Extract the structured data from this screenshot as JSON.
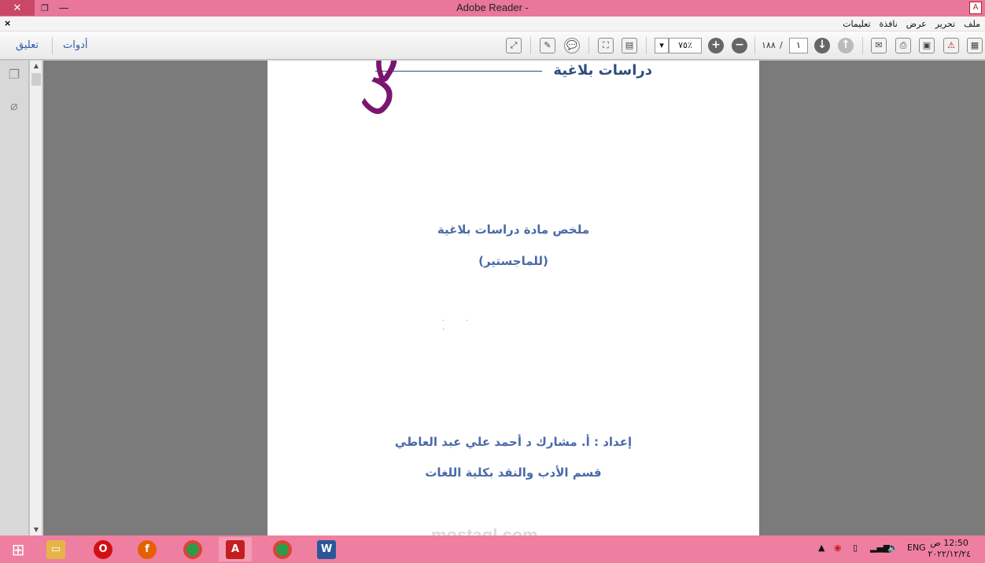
{
  "window": {
    "title": "Adobe Reader -",
    "close_glyph": "✕",
    "restore_glyph": "❐",
    "minimize_glyph": "—"
  },
  "menu": {
    "items": [
      "ملف",
      "تحرير",
      "عرض",
      "نافذة",
      "تعليمات"
    ],
    "close_glyph": "×"
  },
  "toolbar": {
    "tools_label": "أدوات",
    "comment_label": "تعليق",
    "zoom_value": "٧٥٪",
    "page_current": "١",
    "page_total": "١٨٨",
    "page_separator": "/"
  },
  "document": {
    "header_title": "دراسات بلاغية",
    "stamp_text": "تلخيص",
    "summary_title": "ملخص مادة دراسات بلاغية",
    "level": "(للماجستير)",
    "prepared_by": "إعداد : أ. مشارك د أحمد علي عبد العاطي",
    "department": "قسم الأدب والنقد بكلية اللغات",
    "watermark": "mostaql.com"
  },
  "taskbar": {
    "language": "ENG",
    "time": "12:50 ص",
    "date": "٢٠٢٢/١٢/٢٤"
  },
  "colors": {
    "titlebar": "#e8779b",
    "taskbar": "#ef7fa1",
    "link": "#2d5aa8",
    "stamp": "#7a156f",
    "doc_text": "#4a6aa8"
  }
}
